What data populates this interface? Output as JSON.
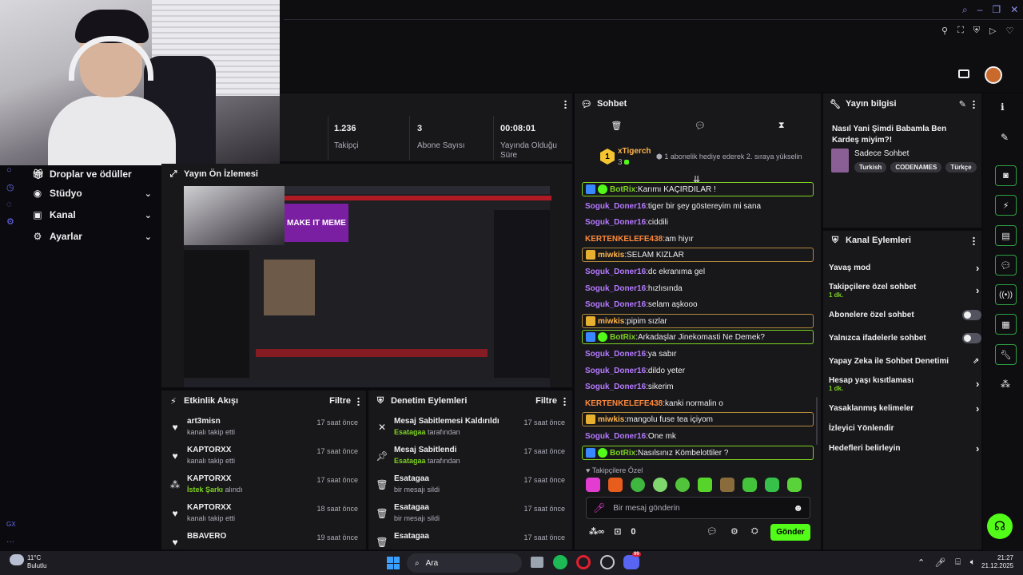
{
  "dashboard": {
    "stats": [
      {
        "value": "1.236",
        "label": "Takipçi"
      },
      {
        "value": "3",
        "label": "Abone Sayısı"
      },
      {
        "value": "00:08:01",
        "label": "Yayında Olduğu Süre"
      }
    ],
    "nav": [
      {
        "label": "Droplar ve ödüller",
        "icon": "gift-icon"
      },
      {
        "label": "Stüdyo",
        "icon": "studio-icon"
      },
      {
        "label": "Kanal",
        "icon": "channel-icon"
      },
      {
        "label": "Ayarlar",
        "icon": "gear-icon"
      }
    ],
    "nav_footer": "GX"
  },
  "preview": {
    "title": "Yayın Ön İzlemesi",
    "inner_text": "MAKE IT MEME"
  },
  "activity": {
    "title": "Etkinlik Akışı",
    "filter": "Filtre",
    "items": [
      {
        "user": "art3misn",
        "text": "kanalı takip etti",
        "time": "17 saat önce",
        "icon": "heart-icon"
      },
      {
        "user": "KAPTORXX",
        "text": "kanalı takip etti",
        "time": "17 saat önce",
        "icon": "heart-icon"
      },
      {
        "user": "KAPTORXX",
        "highlight": "İstek Şarkı",
        "text": "alındı",
        "time": "17 saat önce",
        "icon": "points-icon"
      },
      {
        "user": "KAPTORXX",
        "text": "kanalı takip etti",
        "time": "18 saat önce",
        "icon": "heart-icon"
      },
      {
        "user": "BBAVERO",
        "text": "",
        "time": "19 saat önce",
        "icon": "heart-icon"
      }
    ]
  },
  "moderation": {
    "title": "Denetim Eylemleri",
    "filter": "Filtre",
    "items": [
      {
        "action": "Mesaj Sabitlemesi Kaldırıldı",
        "mod": "Esatagaa",
        "text": "tarafından",
        "time": "17 saat önce",
        "icon": "unpin-icon"
      },
      {
        "action": "Mesaj Sabitlendi",
        "mod": "Esatagaa",
        "text": "tarafından",
        "time": "17 saat önce",
        "icon": "pin-icon"
      },
      {
        "action": "Esatagaa",
        "mod": "",
        "text": "bir mesajı sildi",
        "time": "17 saat önce",
        "icon": "trash-icon"
      },
      {
        "action": "Esatagaa",
        "mod": "",
        "text": "bir mesajı sildi",
        "time": "17 saat önce",
        "icon": "trash-icon"
      },
      {
        "action": "Esatagaa",
        "mod": "",
        "text": "",
        "time": "17 saat önce",
        "icon": "trash-icon"
      }
    ]
  },
  "chat": {
    "title": "Sohbet",
    "gifter": {
      "rank": "1",
      "name": "xTigerch",
      "count": "3",
      "note": "1 abonelik hediye ederek 2. sıraya yükselin"
    },
    "messages": [
      {
        "user": "BotRix",
        "text": "Karımı KAÇIRDILAR !",
        "color": "u-g",
        "style": "hl",
        "badge": "bot"
      },
      {
        "user": "Soguk_Doner16",
        "text": "tiger bir şey göstereyim mi sana",
        "color": "u-p",
        "style": "",
        "badge": ""
      },
      {
        "user": "Soguk_Doner16",
        "text": "ciddili",
        "color": "u-p",
        "style": "",
        "badge": ""
      },
      {
        "user": "KERTENKELEFE438",
        "text": "am hiyır",
        "color": "u-o",
        "style": "",
        "badge": ""
      },
      {
        "user": "miwkis",
        "text": "SELAM KIZLAR",
        "color": "u-y",
        "style": "sub",
        "badge": "crown"
      },
      {
        "user": "Soguk_Doner16",
        "text": "dc ekranıma gel",
        "color": "u-p",
        "style": "",
        "badge": ""
      },
      {
        "user": "Soguk_Doner16",
        "text": "hızlısında",
        "color": "u-p",
        "style": "",
        "badge": ""
      },
      {
        "user": "Soguk_Doner16",
        "text": "selam aşkooo",
        "color": "u-p",
        "style": "",
        "badge": ""
      },
      {
        "user": "miwkis",
        "text": "pipim sızlar",
        "color": "u-y",
        "style": "sub",
        "badge": "crown"
      },
      {
        "user": "BotRix",
        "text": "Arkadaşlar Jinekomasti Ne Demek?",
        "color": "u-g",
        "style": "hl",
        "badge": "bot"
      },
      {
        "user": "Soguk_Doner16",
        "text": "ya sabır",
        "color": "u-p",
        "style": "",
        "badge": ""
      },
      {
        "user": "Soguk_Doner16",
        "text": "dildo yeter",
        "color": "u-p",
        "style": "",
        "badge": ""
      },
      {
        "user": "Soguk_Doner16",
        "text": "sikerim",
        "color": "u-p",
        "style": "",
        "badge": ""
      },
      {
        "user": "KERTENKELEFE438",
        "text": "kanki normalin o",
        "color": "u-o",
        "style": "",
        "badge": ""
      },
      {
        "user": "miwkis",
        "text": "mangolu fuse tea içiyom",
        "color": "u-y",
        "style": "sub",
        "badge": "crown"
      },
      {
        "user": "Soguk_Doner16",
        "text": "One mk",
        "color": "u-p",
        "style": "",
        "badge": ""
      },
      {
        "user": "BotRix",
        "text": "Nasılsınız Kömbelottiler ?",
        "color": "u-g",
        "style": "hl",
        "badge": "bot"
      }
    ],
    "emote_section": "Takipçilere Özel",
    "placeholder": "Bir mesaj gönderin",
    "points": "0",
    "send": "Gönder"
  },
  "stream_info": {
    "title": "Yayın bilgisi",
    "stream_title": "Nasıl Yani Şimdi Babamla Ben Kardeş miyim?!",
    "category": "Sadece Sohbet",
    "tags": [
      "Turkish",
      "CODENAMES",
      "Türkçe"
    ]
  },
  "channel_actions": {
    "title": "Kanal Eylemleri",
    "items": [
      {
        "label": "Yavaş mod",
        "sub": "",
        "control": "chevron"
      },
      {
        "label": "Takipçilere özel sohbet",
        "sub": "1 dk.",
        "control": "chevron"
      },
      {
        "label": "Abonelere özel sohbet",
        "sub": "",
        "control": "toggle"
      },
      {
        "label": "Yalnızca ifadelerle sohbet",
        "sub": "",
        "control": "toggle"
      },
      {
        "label": "Yapay Zeka ile Sohbet Denetimi",
        "sub": "",
        "control": "external"
      },
      {
        "label": "Hesap yaşı kısıtlaması",
        "sub": "1 dk.",
        "control": "chevron"
      },
      {
        "label": "Yasaklanmış kelimeler",
        "sub": "",
        "control": "chevron"
      },
      {
        "label": "İzleyici Yönlendir",
        "sub": "",
        "control": "none"
      },
      {
        "label": "Hedefleri belirleyin",
        "sub": "",
        "control": "chevron"
      }
    ]
  },
  "taskbar": {
    "weather_temp": "11°C",
    "weather_desc": "Bulutlu",
    "search": "Ara",
    "time": "21:27",
    "date": "21.12.2025",
    "discord_badge": "99"
  },
  "colors": {
    "accent": "#53fc18",
    "panel": "#18181b",
    "bg": "#0b0b0f"
  }
}
